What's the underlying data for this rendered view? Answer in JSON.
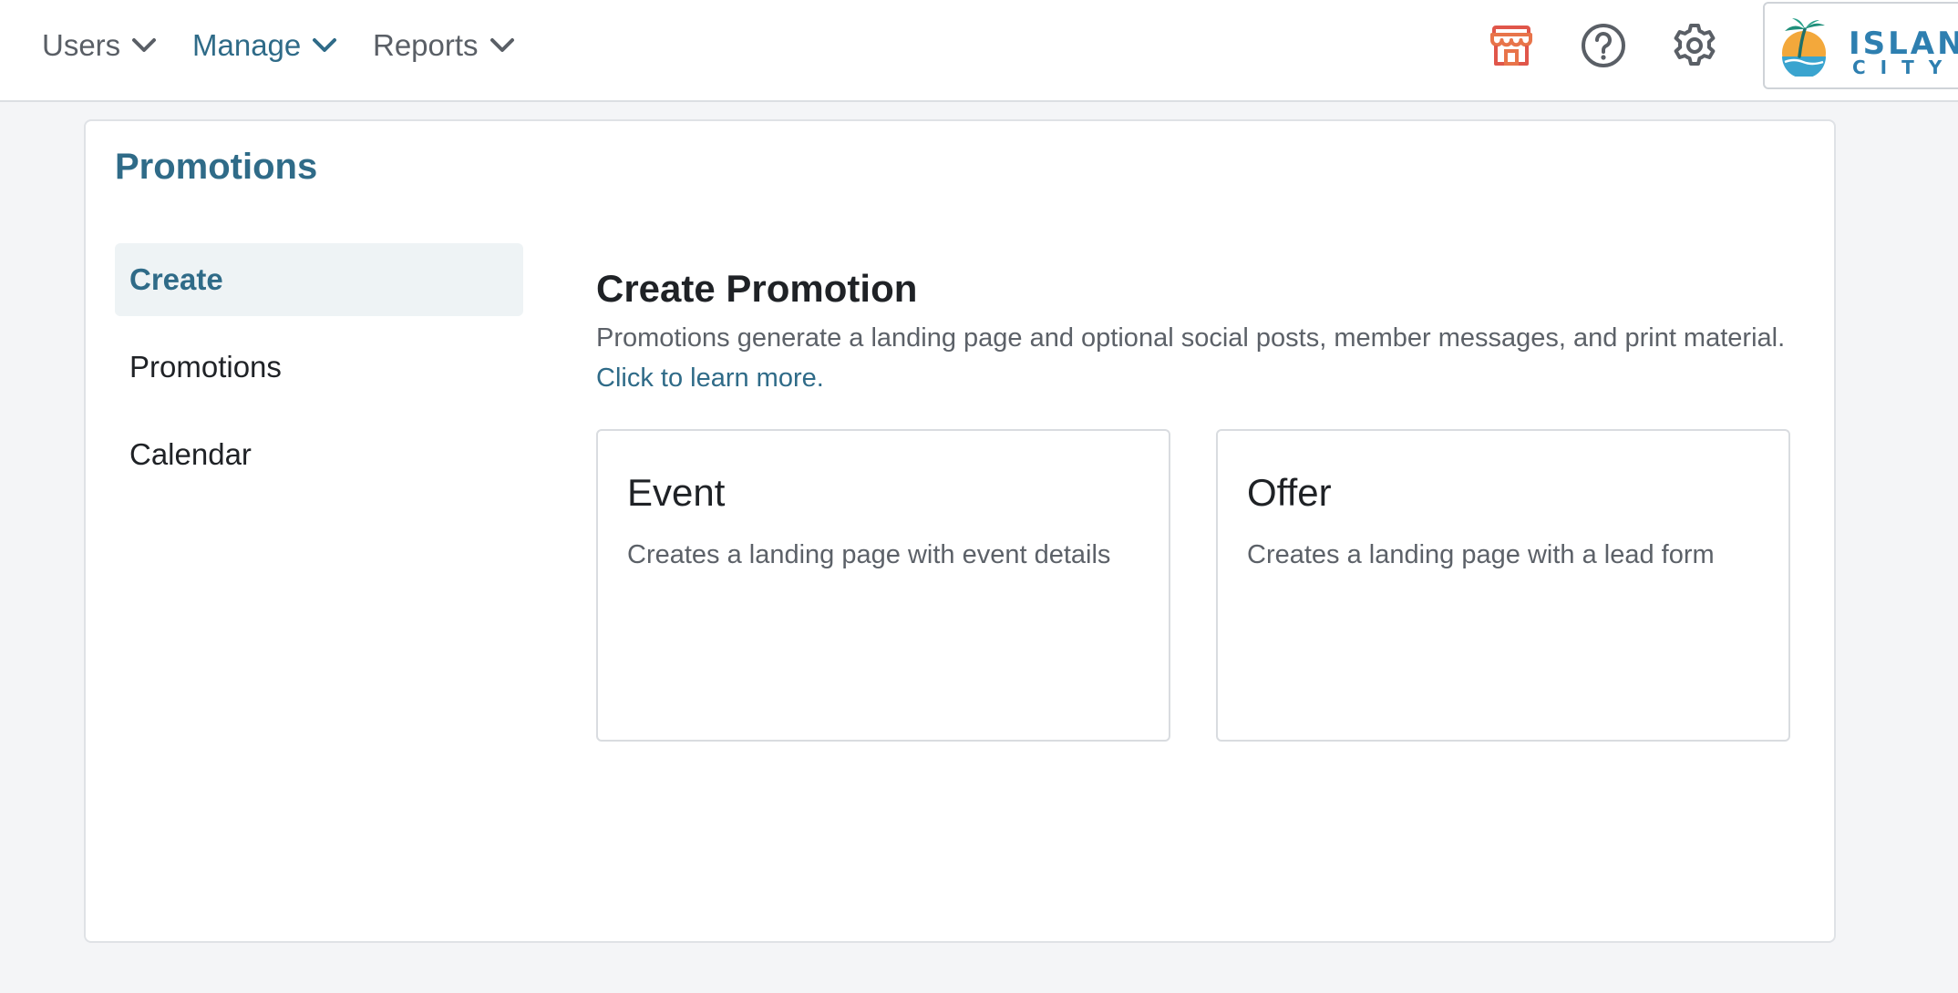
{
  "nav": {
    "items": [
      {
        "label": "Users"
      },
      {
        "label": "Manage"
      },
      {
        "label": "Reports"
      }
    ]
  },
  "logo": {
    "line1": "ISLAND",
    "line2": "CITY"
  },
  "icons": {
    "store": "storefront-icon",
    "help": "help-icon",
    "settings": "gear-icon"
  },
  "colors": {
    "accent": "#2f6b88",
    "store_icon": "#e0564a",
    "background": "#f4f5f7"
  },
  "page": {
    "title": "Promotions"
  },
  "sidebar": {
    "items": [
      {
        "label": "Create"
      },
      {
        "label": "Promotions"
      },
      {
        "label": "Calendar"
      }
    ]
  },
  "main": {
    "title": "Create Promotion",
    "description": "Promotions generate a landing page and optional social posts, member messages, and print material.",
    "learn_more": "Click to learn more.",
    "options": [
      {
        "title": "Event",
        "description": "Creates a landing page with event details"
      },
      {
        "title": "Offer",
        "description": "Creates a landing page with a lead form"
      }
    ]
  }
}
